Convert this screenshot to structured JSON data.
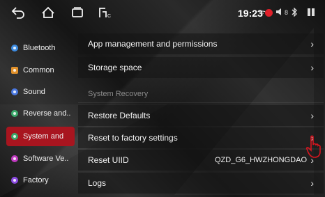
{
  "statusbar": {
    "time": "19:23",
    "icons": [
      "back-icon",
      "home-icon",
      "recent-apps-icon",
      "media-source-icon",
      "signal-icon",
      "record-icon",
      "volume-icon",
      "bluetooth-icon",
      "split-screen-icon"
    ],
    "volume_level": "8"
  },
  "sidebar": {
    "items": [
      {
        "label": "Bluetooth",
        "color": "#3d8be0"
      },
      {
        "label": "Common",
        "color": "#e0902a"
      },
      {
        "label": "Sound",
        "color": "#4a78e0"
      },
      {
        "label": "Reverse and..",
        "color": "#3aa86a"
      },
      {
        "label": "System and",
        "color": "#3aa86a",
        "active": true
      },
      {
        "label": "Software Ve..",
        "color": "#c03ac0"
      },
      {
        "label": "Factory",
        "color": "#8a4ae0"
      }
    ],
    "active_color": "#a8151f"
  },
  "main": {
    "rows": [
      {
        "label": "App management and permissions"
      },
      {
        "label": "Storage space"
      }
    ],
    "section_title": "System Recovery",
    "recovery_rows": [
      {
        "label": "Restore Defaults"
      },
      {
        "label": "Reset to factory settings"
      },
      {
        "label": "Reset UIID",
        "value": "QZD_G6_HWZHONGDAO"
      },
      {
        "label": "Logs"
      }
    ]
  }
}
